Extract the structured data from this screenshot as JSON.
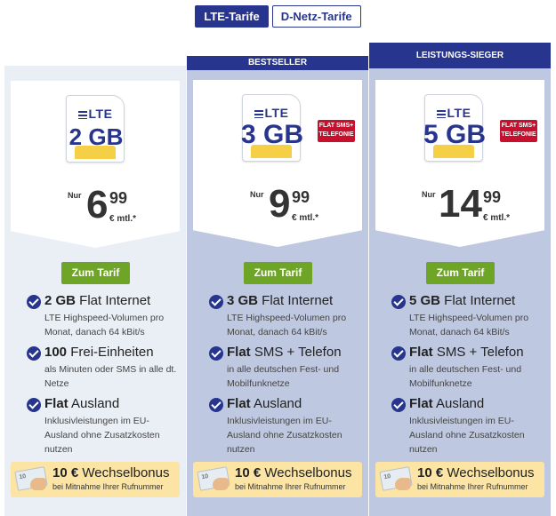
{
  "tabs": {
    "lte": "LTE-Tarife",
    "dnetz": "D-Netz-Tarife"
  },
  "colors": {
    "brand_blue": "#27358f",
    "button_green": "#6fa527",
    "badge_red": "#c8102e",
    "bonus_bg": "#fbe4a4"
  },
  "tariffs": [
    {
      "ribbon": "",
      "sim_brand": "LTE",
      "volume": "2 GB",
      "flat_badge": "",
      "price_prefix": "Nur",
      "price_euro": "6",
      "price_cents": "99",
      "price_suffix": "€ mtl.*",
      "button": "Zum Tarif",
      "features": [
        {
          "title_bold": "2 GB",
          "title_rest": " Flat Internet",
          "desc": "LTE Highspeed-Volumen pro Monat, danach 64 kBit/s"
        },
        {
          "title_bold": "100",
          "title_rest": " Frei-Einheiten",
          "desc": "als Minuten oder SMS in alle dt. Netze"
        },
        {
          "title_bold": "Flat",
          "title_rest": " Ausland",
          "desc": "Inklusivleistungen im EU-Ausland ohne Zusatzkosten nutzen"
        }
      ],
      "bonus_title_bold": "10 €",
      "bonus_title_rest": " Wechselbonus",
      "bonus_sub": "bei Mitnahme Ihrer Rufnummer"
    },
    {
      "ribbon": "BESTSELLER",
      "sim_brand": "LTE",
      "volume": "3 GB",
      "flat_badge": "FLAT SMS+ TELEFONIE",
      "price_prefix": "Nur",
      "price_euro": "9",
      "price_cents": "99",
      "price_suffix": "€ mtl.*",
      "button": "Zum Tarif",
      "features": [
        {
          "title_bold": "3 GB",
          "title_rest": " Flat Internet",
          "desc": "LTE Highspeed-Volumen pro Monat, danach 64 kBit/s"
        },
        {
          "title_bold": "Flat",
          "title_rest": " SMS + Telefon",
          "desc": "in alle deutschen Fest- und Mobilfunknetze"
        },
        {
          "title_bold": "Flat",
          "title_rest": " Ausland",
          "desc": "Inklusivleistungen im EU-Ausland ohne Zusatzkosten nutzen"
        }
      ],
      "bonus_title_bold": "10 €",
      "bonus_title_rest": " Wechselbonus",
      "bonus_sub": "bei Mitnahme Ihrer Rufnummer"
    },
    {
      "ribbon": "LEISTUNGS-SIEGER",
      "sim_brand": "LTE",
      "volume": "5 GB",
      "flat_badge": "FLAT SMS+ TELEFONIE",
      "price_prefix": "Nur",
      "price_euro": "14",
      "price_cents": "99",
      "price_suffix": "€ mtl.*",
      "button": "Zum Tarif",
      "features": [
        {
          "title_bold": "5 GB",
          "title_rest": " Flat Internet",
          "desc": "LTE Highspeed-Volumen pro Monat, danach 64 kBit/s"
        },
        {
          "title_bold": "Flat",
          "title_rest": " SMS + Telefon",
          "desc": "in alle deutschen Fest- und Mobilfunknetze"
        },
        {
          "title_bold": "Flat",
          "title_rest": " Ausland",
          "desc": "Inklusivleistungen im EU-Ausland ohne Zusatzkosten nutzen"
        }
      ],
      "bonus_title_bold": "10 €",
      "bonus_title_rest": " Wechselbonus",
      "bonus_sub": "bei Mitnahme Ihrer Rufnummer"
    }
  ]
}
